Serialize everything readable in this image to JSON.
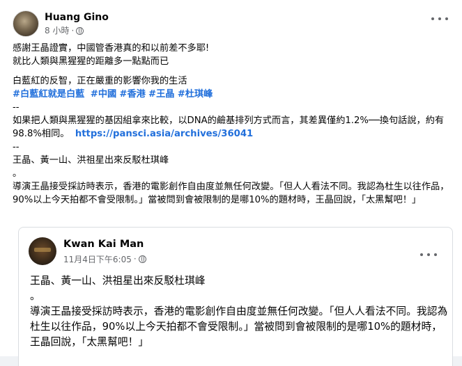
{
  "post": {
    "author": "Huang Gino",
    "time": "8 小時",
    "dot": "·",
    "lines_a": [
      "感謝王晶證實，中國管香港真的和以前差不多耶!",
      "就比人類與黑猩猩的距離多一點點而已"
    ],
    "lines_b": [
      "白藍紅的反智，正在嚴重的影響你我的生活"
    ],
    "hashtags": [
      "#白藍紅就是白藍",
      "#中國",
      "#香港",
      "#王晶",
      "#杜琪峰"
    ],
    "sep1": "--",
    "para": "如果把人類與黑猩猩的基因組拿來比較，以DNA的鹼基排列方式而言，其差異僅約1.2%──換句話說，約有98.8%相同。",
    "link": "https://pansci.asia/archives/36041",
    "sep2": "--",
    "quote_title": "王晶、黃一山、洪祖星出來反駁杜琪峰",
    "quote_mark": "。",
    "quote_body": "導演王晶接受採訪時表示，香港的電影創作自由度並無任何改變。「但人人看法不同。我認為杜生以往作品，90%以上今天拍都不會受限制。」當被問到會被限制的是哪10%的題材時，王晶回說，「太黑幫吧！」"
  },
  "shared": {
    "author": "Kwan Kai Man",
    "time": "11月4日下午6:05",
    "dot": "·",
    "title": "王晶、黃一山、洪祖星出來反駁杜琪峰",
    "mark": "。",
    "body": "導演王晶接受採訪時表示，香港的電影創作自由度並無任何改變。「但人人看法不同。我認為杜生以往作品，90%以上今天拍都不會受限制。」當被問到會被限制的是哪10%的題材時，王晶回說，「太黑幫吧！」"
  },
  "icons": {
    "privacy": "globe-icon",
    "menu": "more-horizontal-icon"
  },
  "colors": {
    "link": "#216fdb",
    "meta": "#65676b",
    "background": "#f0f2f5"
  }
}
